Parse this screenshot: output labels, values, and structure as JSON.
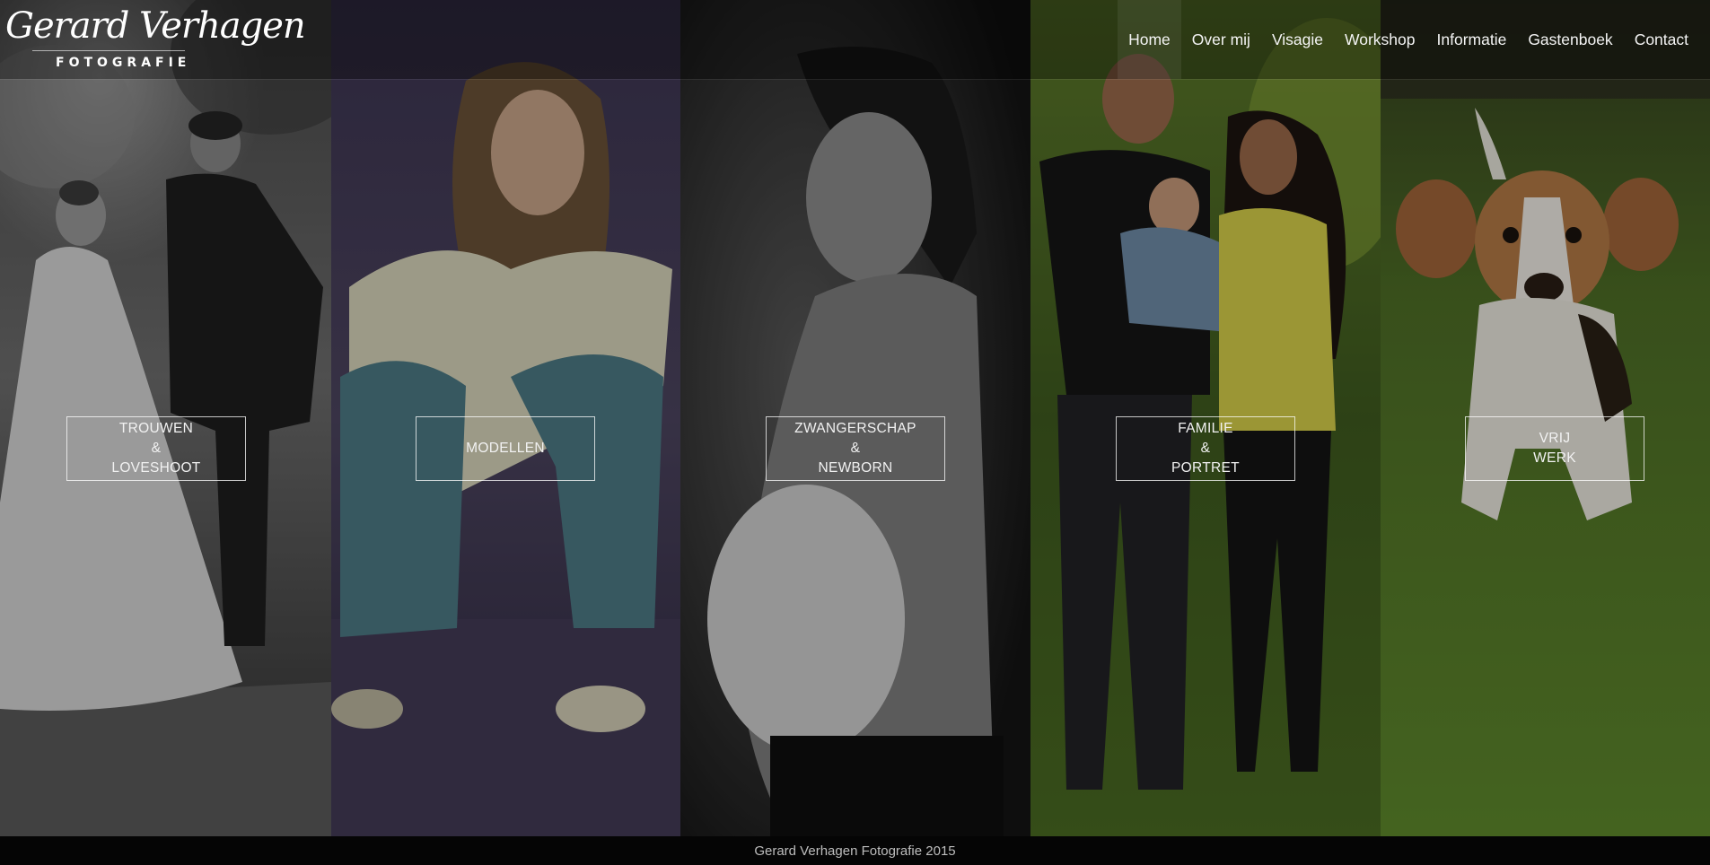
{
  "header": {
    "logo_script": "Gerard Verhagen",
    "logo_sub": "FOTOGRAFIE"
  },
  "nav": {
    "items": [
      {
        "label": "Home"
      },
      {
        "label": "Over mij"
      },
      {
        "label": "Visagie"
      },
      {
        "label": "Workshop"
      },
      {
        "label": "Informatie"
      },
      {
        "label": "Gastenboek"
      },
      {
        "label": "Contact"
      }
    ]
  },
  "panels": [
    {
      "lines": [
        "TROUWEN",
        "&",
        "LOVESHOOT"
      ]
    },
    {
      "lines": [
        "MODELLEN"
      ]
    },
    {
      "lines": [
        "ZWANGERSCHAP",
        "&",
        "NEWBORN"
      ]
    },
    {
      "lines": [
        "FAMILIE",
        "&",
        "PORTRET"
      ]
    },
    {
      "lines": [
        "VRIJ",
        "WERK"
      ]
    }
  ],
  "footer": {
    "text": "Gerard Verhagen Fotografie 2015"
  }
}
